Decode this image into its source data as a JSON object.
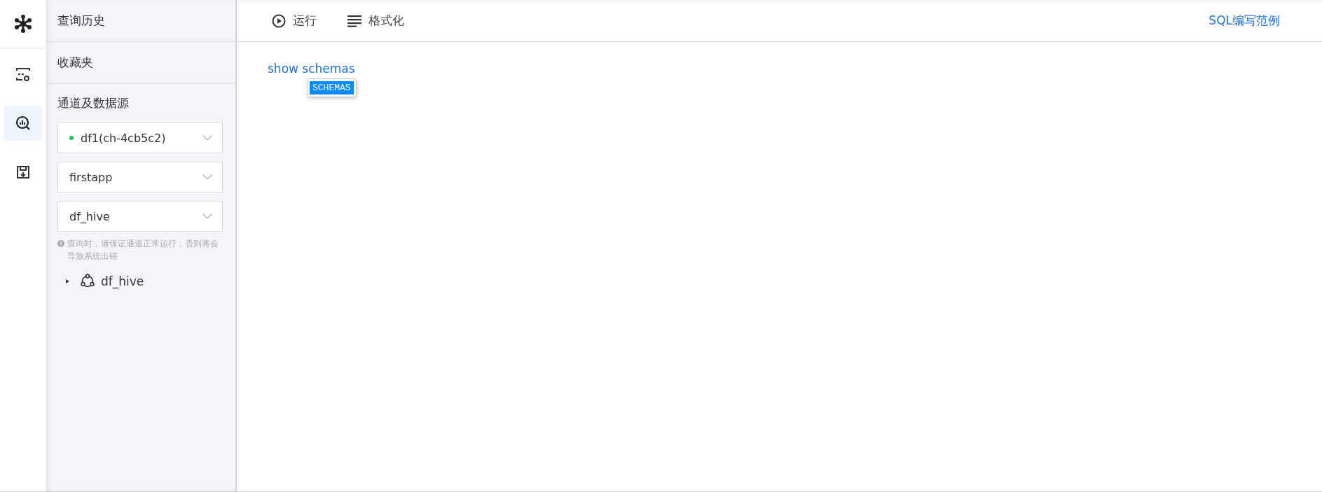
{
  "rail": {
    "items": [
      {
        "kind": "table-settings",
        "selected": false
      },
      {
        "kind": "query",
        "selected": true
      },
      {
        "kind": "save",
        "selected": false
      }
    ]
  },
  "sidebar": {
    "sections": [
      {
        "label": "查询历史"
      },
      {
        "label": "收藏夹"
      }
    ],
    "source_title": "通道及数据源",
    "selects": [
      {
        "value": "df1(ch-4cb5c2)",
        "connected": true
      },
      {
        "value": "firstapp",
        "connected": false
      },
      {
        "value": "df_hive",
        "connected": false
      }
    ],
    "hint": "查询时，请保证通道正常运行，否则将会导致系统出错",
    "tree": [
      {
        "label": "df_hive",
        "expanded": false
      }
    ]
  },
  "toolbar": {
    "buttons": [
      {
        "kind": "run",
        "label": "运行"
      },
      {
        "kind": "format",
        "label": "格式化"
      }
    ],
    "link": "SQL编写范例"
  },
  "editor": {
    "text": "show schemas",
    "suggestions": [
      {
        "label": "SCHEMAS",
        "selected": true
      }
    ]
  }
}
